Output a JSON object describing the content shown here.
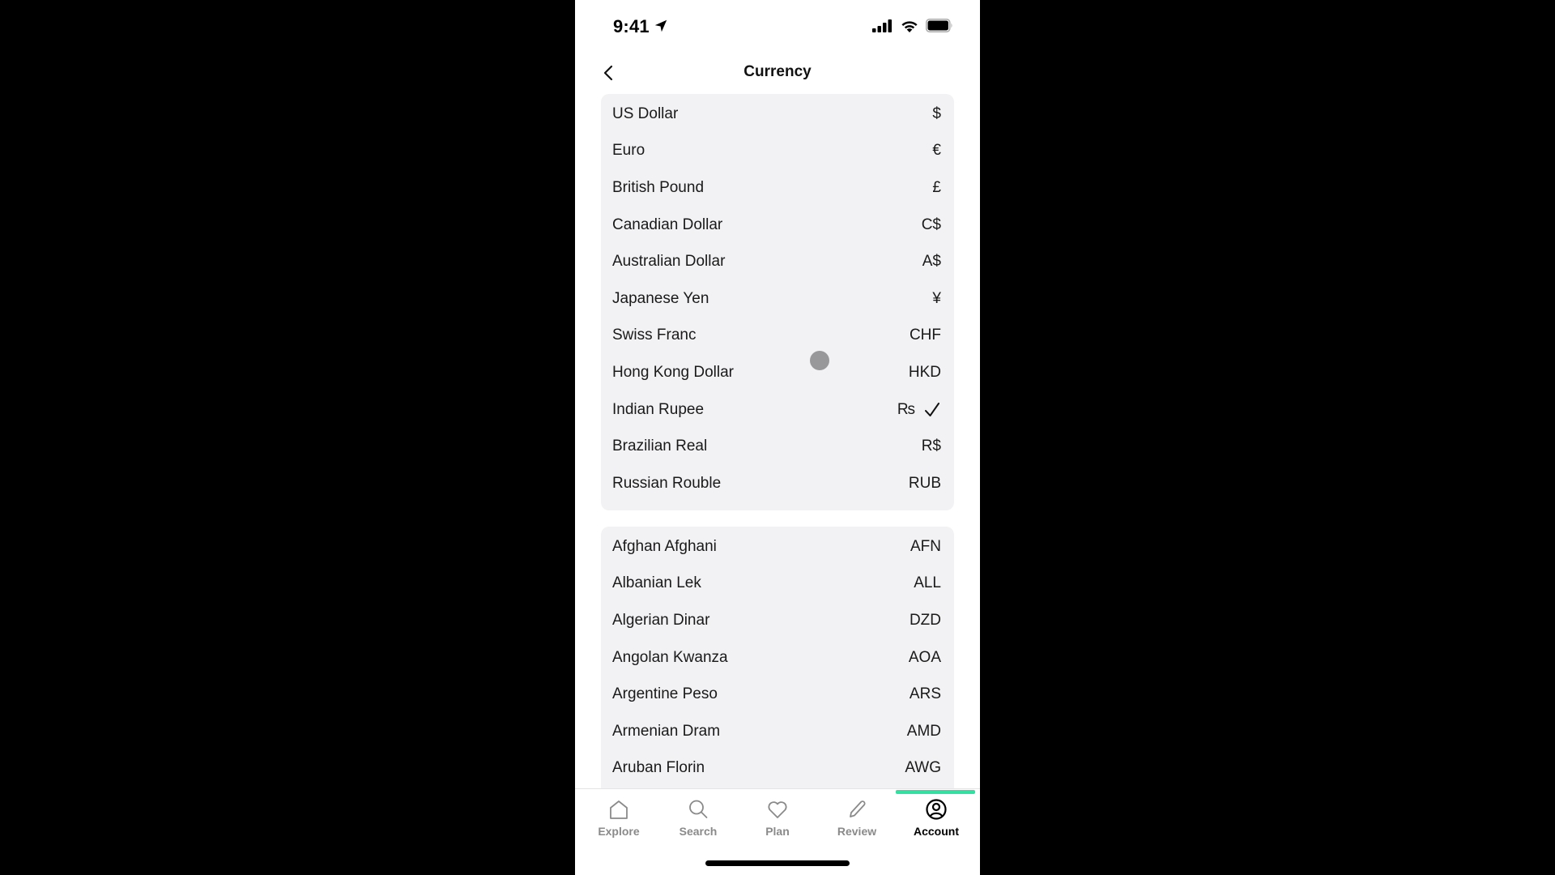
{
  "status_bar": {
    "time": "9:41",
    "icons": [
      "location-arrow-icon",
      "cellular-signal-icon",
      "wifi-icon",
      "battery-icon"
    ]
  },
  "nav": {
    "title": "Currency",
    "back_icon": "chevron-left-icon"
  },
  "popular_currencies": [
    {
      "name": "US Dollar",
      "symbol": "$",
      "selected": false
    },
    {
      "name": "Euro",
      "symbol": "€",
      "selected": false
    },
    {
      "name": "British Pound",
      "symbol": "£",
      "selected": false
    },
    {
      "name": "Canadian Dollar",
      "symbol": "C$",
      "selected": false
    },
    {
      "name": "Australian Dollar",
      "symbol": "A$",
      "selected": false
    },
    {
      "name": "Japanese Yen",
      "symbol": "¥",
      "selected": false
    },
    {
      "name": "Swiss Franc",
      "symbol": "CHF",
      "selected": false
    },
    {
      "name": "Hong Kong Dollar",
      "symbol": "HKD",
      "selected": false
    },
    {
      "name": "Indian Rupee",
      "symbol": "₨",
      "selected": true
    },
    {
      "name": "Brazilian Real",
      "symbol": "R$",
      "selected": false
    },
    {
      "name": "Russian Rouble",
      "symbol": "RUB",
      "selected": false
    }
  ],
  "all_currencies": [
    {
      "name": "Afghan Afghani",
      "symbol": "AFN"
    },
    {
      "name": "Albanian Lek",
      "symbol": "ALL"
    },
    {
      "name": "Algerian Dinar",
      "symbol": "DZD"
    },
    {
      "name": "Angolan Kwanza",
      "symbol": "AOA"
    },
    {
      "name": "Argentine Peso",
      "symbol": "ARS"
    },
    {
      "name": "Armenian Dram",
      "symbol": "AMD"
    },
    {
      "name": "Aruban Florin",
      "symbol": "AWG"
    }
  ],
  "tab_bar": {
    "tabs": [
      {
        "label": "Explore",
        "icon": "home-icon",
        "active": false
      },
      {
        "label": "Search",
        "icon": "search-icon",
        "active": false
      },
      {
        "label": "Plan",
        "icon": "heart-icon",
        "active": false
      },
      {
        "label": "Review",
        "icon": "pencil-icon",
        "active": false
      },
      {
        "label": "Account",
        "icon": "account-icon",
        "active": true
      }
    ],
    "accent_color": "#34e0a1"
  }
}
